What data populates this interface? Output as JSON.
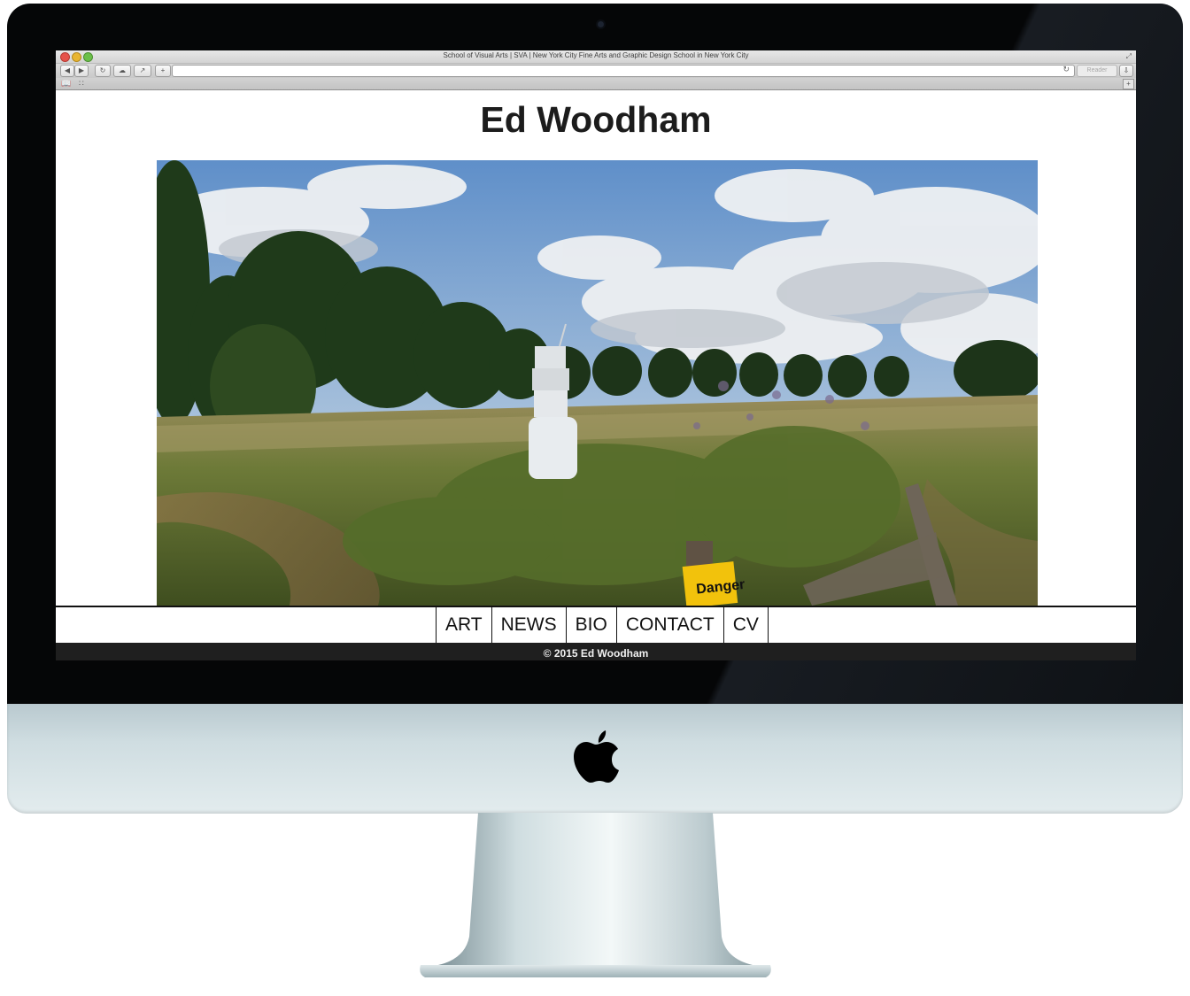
{
  "browser": {
    "window_title": "School of Visual Arts | SVA | New York City Fine Arts and Graphic Design School in New York City",
    "reader_label": "Reader"
  },
  "site": {
    "title": "Ed Woodham",
    "hero_sign_text": "Danger",
    "nav": [
      "ART",
      "NEWS",
      "BIO",
      "CONTACT",
      "CV"
    ],
    "footer": "© 2015 Ed Woodham"
  },
  "icons": {
    "back": "back-arrow-icon",
    "forward": "forward-arrow-icon",
    "reload": "reload-icon",
    "share": "share-icon",
    "icloud": "cloud-icon",
    "add": "plus-icon",
    "download": "download-icon",
    "bookmarks": "book-icon",
    "top_sites": "grid-icon",
    "brand": "apple-logo-icon"
  },
  "colors": {
    "bezel": "#050607",
    "chin": "#cfdde1",
    "footer_bg": "#1f1f1f",
    "title_text": "#1c1c1c"
  }
}
